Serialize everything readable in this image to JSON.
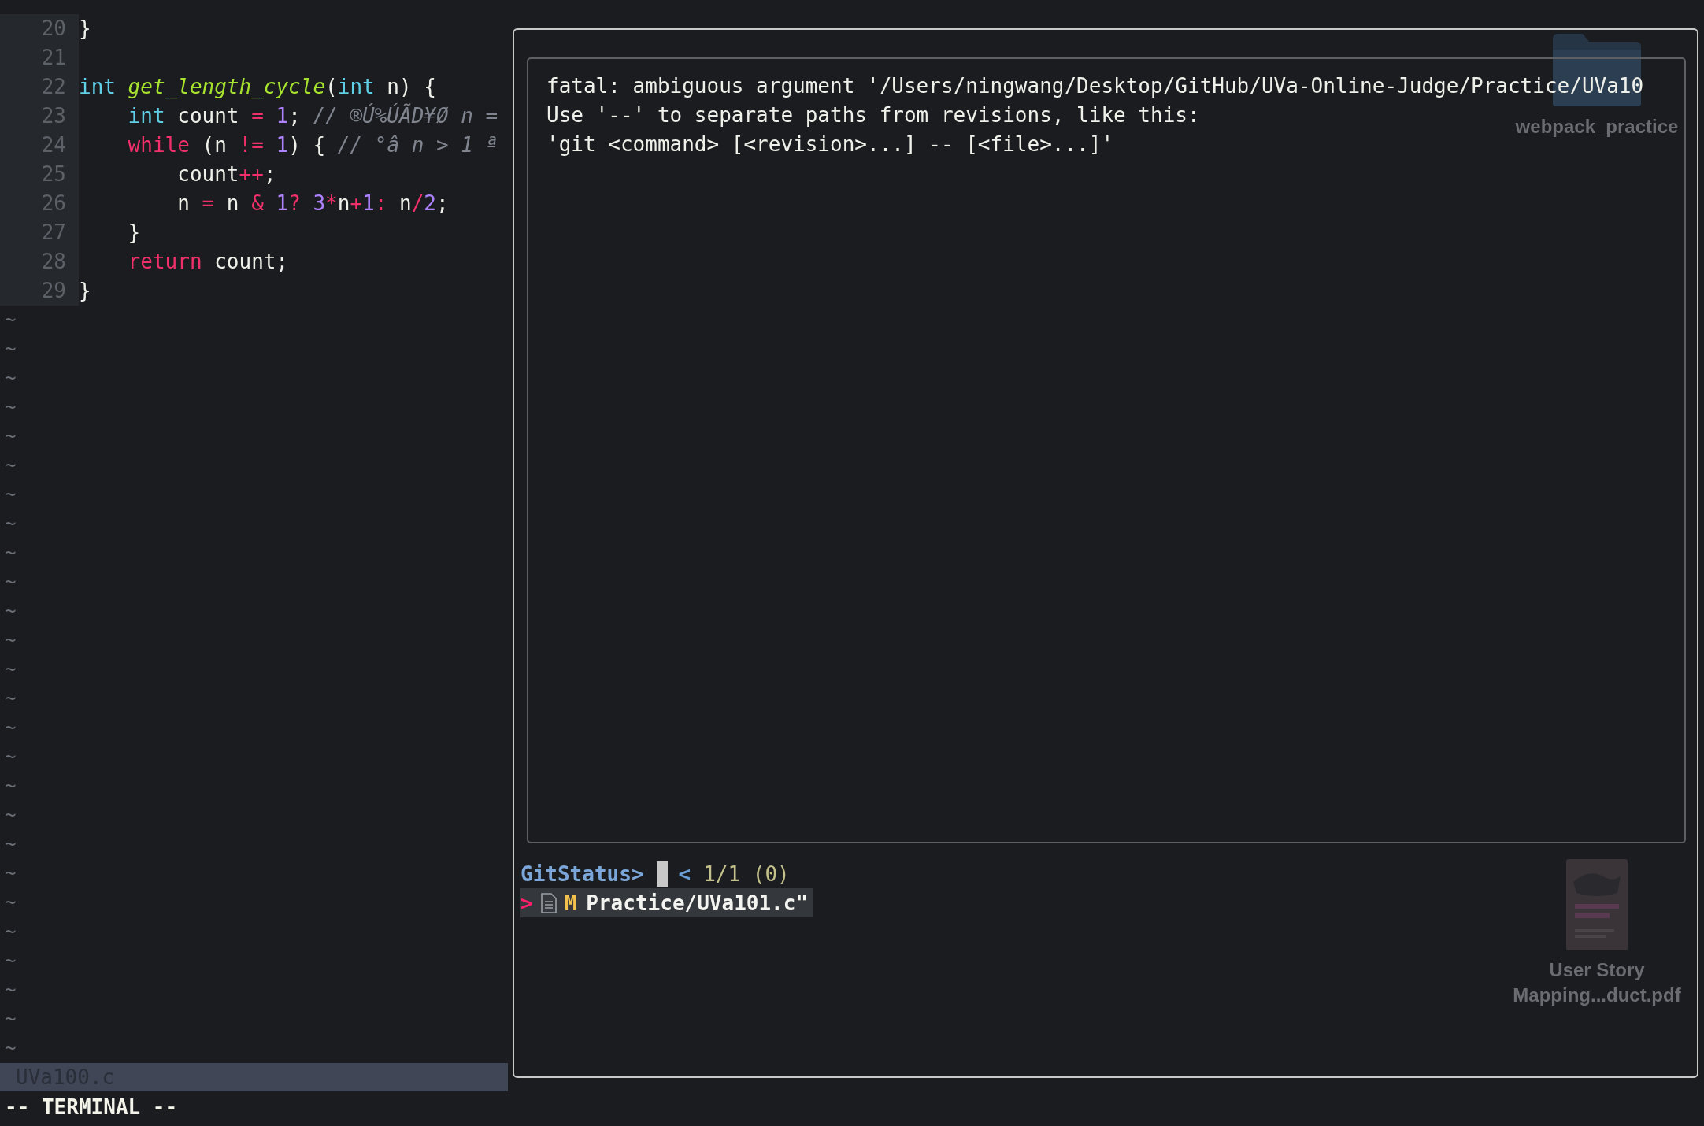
{
  "editor": {
    "code_lines": [
      {
        "number": "20",
        "tokens": [
          {
            "kind": "plain",
            "text": "}"
          }
        ]
      },
      {
        "number": "21"
      },
      {
        "number": "22",
        "tokens": [
          {
            "kind": "type",
            "text": "int"
          },
          {
            "kind": "function",
            "text": " get_length_cycle"
          },
          {
            "kind": "plain",
            "text": "("
          },
          {
            "kind": "type",
            "text": "int"
          },
          {
            "kind": "plain",
            "text": " n) {"
          }
        ]
      },
      {
        "number": "23",
        "tokens": [
          {
            "kind": "type",
            "text": "    int"
          },
          {
            "kind": "plain",
            "text": " count"
          },
          {
            "kind": "operator",
            "text": " ="
          },
          {
            "kind": "number",
            "text": " 1"
          },
          {
            "kind": "plain",
            "text": ";"
          },
          {
            "kind": "comment",
            "text": " // ®Ú%ÚÃD¥Ø n ="
          }
        ]
      },
      {
        "number": "24",
        "tokens": [
          {
            "kind": "keyword",
            "text": "    while"
          },
          {
            "kind": "plain",
            "text": " (n"
          },
          {
            "kind": "operator",
            "text": " !="
          },
          {
            "kind": "number",
            "text": " 1"
          },
          {
            "kind": "plain",
            "text": ") {"
          },
          {
            "kind": "comment",
            "text": " // °â n > 1 ª"
          }
        ]
      },
      {
        "number": "25",
        "tokens": [
          {
            "kind": "plain",
            "text": "        count"
          },
          {
            "kind": "operator",
            "text": "++"
          },
          {
            "kind": "plain",
            "text": ";"
          }
        ]
      },
      {
        "number": "26",
        "tokens": [
          {
            "kind": "plain",
            "text": "        n"
          },
          {
            "kind": "operator",
            "text": " ="
          },
          {
            "kind": "plain",
            "text": " n"
          },
          {
            "kind": "operator",
            "text": " &"
          },
          {
            "kind": "number",
            "text": " 1"
          },
          {
            "kind": "operator",
            "text": "?"
          },
          {
            "kind": "number",
            "text": " 3"
          },
          {
            "kind": "operator",
            "text": "*"
          },
          {
            "kind": "plain",
            "text": "n"
          },
          {
            "kind": "operator",
            "text": "+"
          },
          {
            "kind": "number",
            "text": "1"
          },
          {
            "kind": "operator",
            "text": ":"
          },
          {
            "kind": "plain",
            "text": " n"
          },
          {
            "kind": "operator",
            "text": "/"
          },
          {
            "kind": "number",
            "text": "2"
          },
          {
            "kind": "plain",
            "text": ";"
          }
        ]
      },
      {
        "number": "27",
        "tokens": [
          {
            "kind": "plain",
            "text": "    }"
          }
        ]
      },
      {
        "number": "28",
        "tokens": [
          {
            "kind": "keyword",
            "text": "    return"
          },
          {
            "kind": "plain",
            "text": " count;"
          }
        ]
      },
      {
        "number": "29",
        "tokens": [
          {
            "kind": "plain",
            "text": "}"
          }
        ]
      }
    ],
    "empty_line_markers": [
      "~",
      "~",
      "~",
      "~",
      "~",
      "~",
      "~",
      "~",
      "~",
      "~",
      "~",
      "~",
      "~",
      "~",
      "~",
      "~",
      "~",
      "~",
      "~",
      "~",
      "~",
      "~",
      "~",
      "~",
      "~",
      "~"
    ],
    "status_bar": {
      "filename": "UVa100.c"
    },
    "mode": "-- TERMINAL --"
  },
  "terminal_popup": {
    "output_lines": [
      "fatal: ambiguous argument '/Users/ningwang/Desktop/GitHub/UVa-Online-Judge/Practice/UVa10",
      "Use '--' to separate paths from revisions, like this:",
      "'git <command> [<revision>...] -- [<file>...]'"
    ],
    "prompt": {
      "label": "GitStatus>",
      "arrow": "<",
      "count": "1/1 (0)"
    },
    "results": [
      {
        "pointer": ">",
        "status": "M",
        "path": "Practice/UVa101.c\"",
        "selected": true
      }
    ]
  },
  "desktop_items": [
    {
      "kind": "folder",
      "label_lines": [
        "webpack_practice"
      ]
    },
    {
      "kind": "document",
      "label_lines": [
        "User Story",
        "Mapping...duct.pdf"
      ]
    }
  ]
}
